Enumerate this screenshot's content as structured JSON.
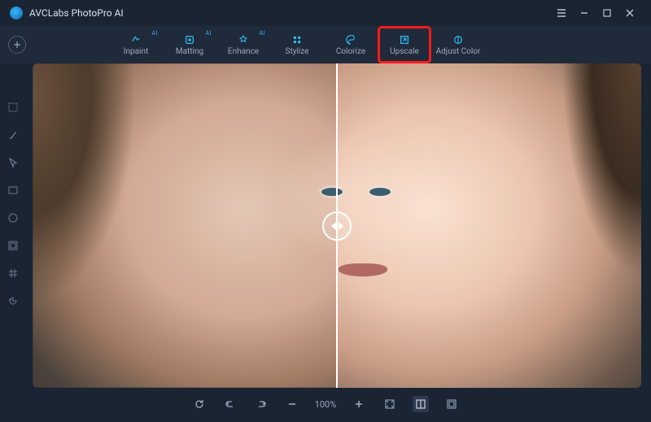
{
  "app": {
    "title": "AVCLabs PhotoPro AI"
  },
  "tools": [
    {
      "key": "inpaint",
      "label": "Inpaint",
      "ai": true
    },
    {
      "key": "matting",
      "label": "Matting",
      "ai": true
    },
    {
      "key": "enhance",
      "label": "Enhance",
      "ai": true
    },
    {
      "key": "stylize",
      "label": "Stylize",
      "ai": false
    },
    {
      "key": "colorize",
      "label": "Colorize",
      "ai": false
    },
    {
      "key": "upscale",
      "label": "Upscale",
      "ai": false,
      "highlighted": true
    },
    {
      "key": "adjustcolor",
      "label": "Adjust Color",
      "ai": false
    }
  ],
  "ai_badge": "AI",
  "zoom": {
    "level": "100%"
  },
  "sidebar_tools": [
    "select-rect",
    "brush",
    "pointer",
    "rectangle",
    "ellipse",
    "aspect",
    "grid",
    "history"
  ],
  "bottombar_tools": [
    "rotate",
    "undo",
    "redo",
    "zoom-out",
    "zoom-level",
    "zoom-in",
    "fit",
    "compare-split",
    "compare-toggle"
  ]
}
